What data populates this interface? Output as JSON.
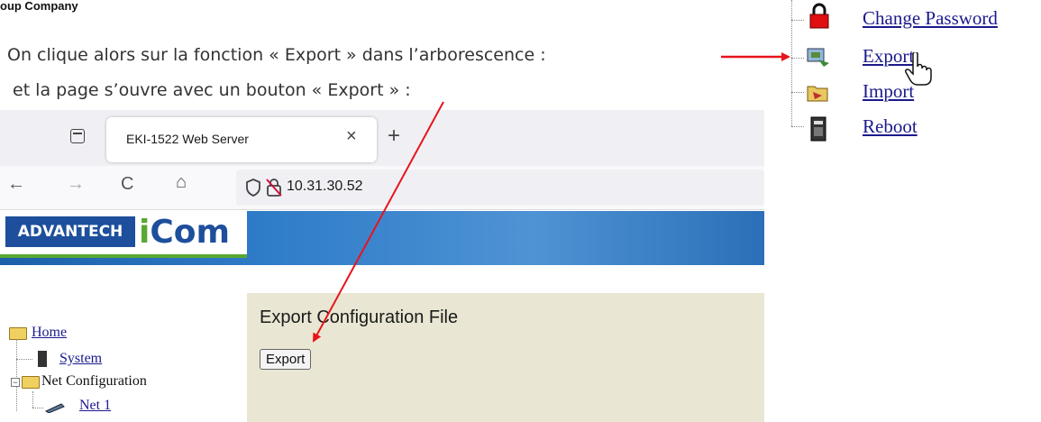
{
  "header_crop": "oup Company",
  "instructions": {
    "line1": "On clique alors sur la fonction « Export » dans l’arborescence :",
    "line2": "et la page s’ouvre avec un bouton « Export » :"
  },
  "right_menu": {
    "items": [
      {
        "label": "Change Password",
        "icon": "lock-icon"
      },
      {
        "label": "Export",
        "icon": "export-icon"
      },
      {
        "label": "Import",
        "icon": "import-icon"
      },
      {
        "label": "Reboot",
        "icon": "reboot-icon"
      }
    ]
  },
  "browser": {
    "tab_title": "EKI-1522 Web Server",
    "tab_close": "×",
    "new_tab": "+",
    "nav_back": "←",
    "nav_forward": "→",
    "nav_reload": "C",
    "nav_home": "⌂",
    "url": "10.31.30.52"
  },
  "banner": {
    "brand_left": "ADVANTECH",
    "brand_right_i": "i",
    "brand_right_rest": "Com"
  },
  "left_tree": {
    "home": "Home",
    "system": "System",
    "net_configuration": "Net Configuration",
    "net1": "Net 1"
  },
  "content": {
    "title": "Export Configuration File",
    "button": "Export"
  },
  "colors": {
    "arrow": "#e8141b",
    "link": "#1a1a8c",
    "panel": "#e9e7d3",
    "banner": "#2f7cc8"
  }
}
